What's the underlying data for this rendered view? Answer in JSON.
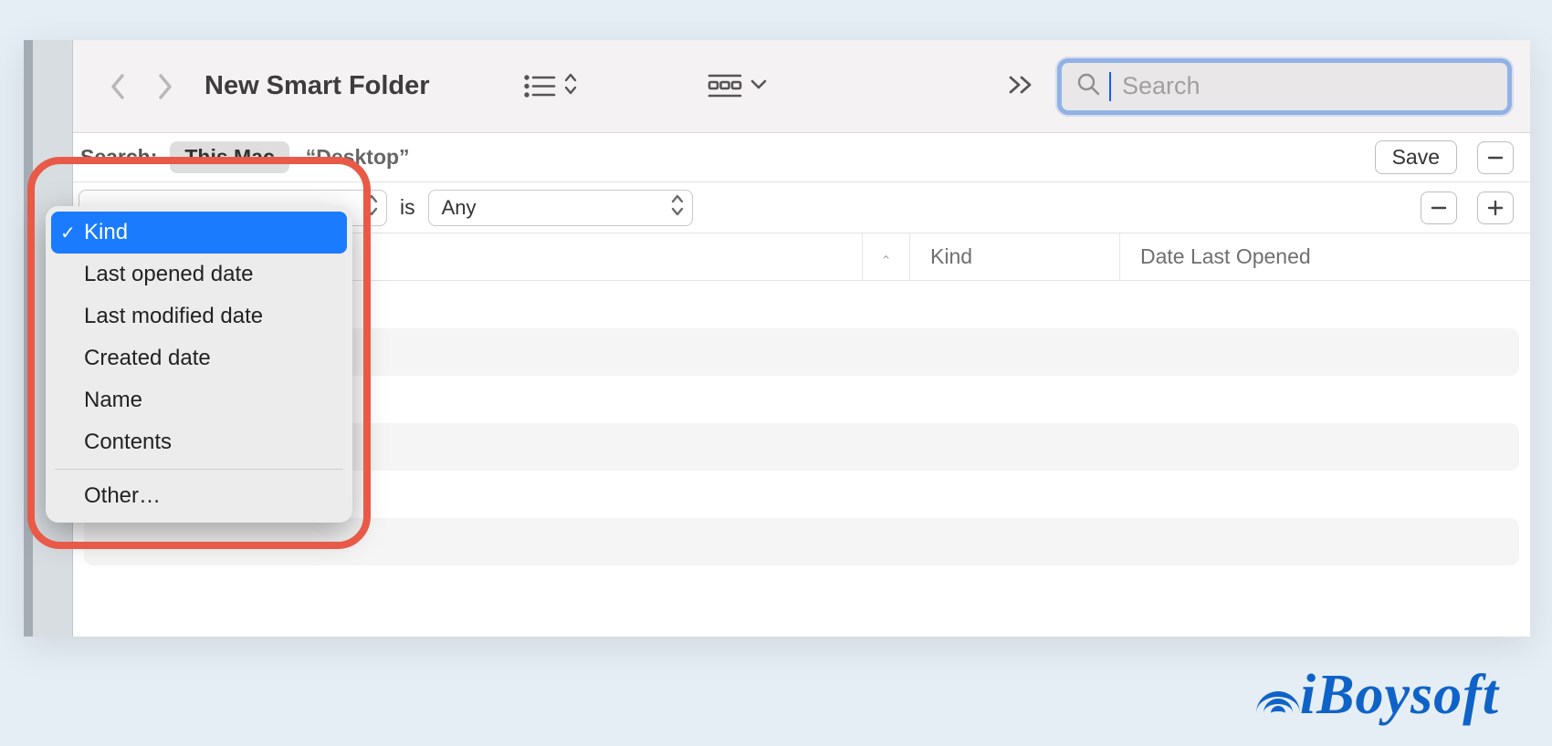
{
  "toolbar": {
    "title": "New Smart Folder",
    "search_placeholder": "Search"
  },
  "scopebar": {
    "label": "Search:",
    "scope_selected": "This Mac",
    "scope_quoted": "“Desktop”",
    "save_label": "Save"
  },
  "criteria": {
    "is_label": "is",
    "value": "Any"
  },
  "columns": {
    "kind": "Kind",
    "date_last_opened": "Date Last Opened"
  },
  "dropdown": {
    "items": [
      "Kind",
      "Last opened date",
      "Last modified date",
      "Created date",
      "Name",
      "Contents"
    ],
    "other": "Other…",
    "selected_index": 0
  },
  "brand": "iBoysoft"
}
